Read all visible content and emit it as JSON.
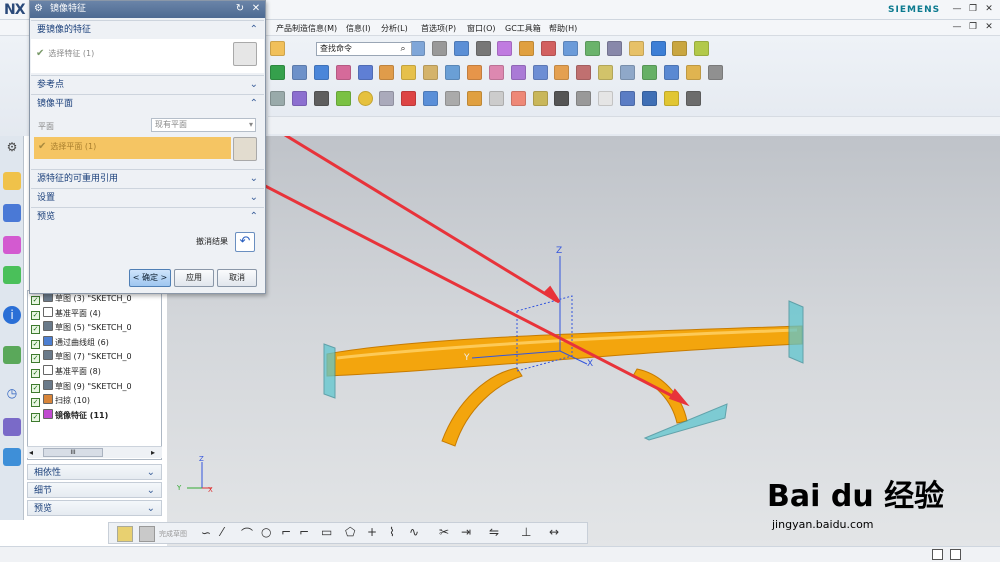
{
  "app": {
    "logo": "NX",
    "brand": "SIEMENS",
    "window_controls": [
      "?",
      "—",
      "❐",
      "✕"
    ]
  },
  "menubar": {
    "items": [
      "产品制造信息(M)",
      "信息(I)",
      "分析(L)",
      "首选项(P)",
      "窗口(O)",
      "GC工具箱",
      "帮助(H)"
    ]
  },
  "toolbar": {
    "command_search_placeholder": "查找命令"
  },
  "dialog": {
    "title": "镜像特征",
    "sections": {
      "features_to_mirror": "要镜像的特征",
      "select_feature": "选择特征 (1)",
      "reference_point": "参考点",
      "mirror_plane": "镜像平面",
      "plane_label": "平面",
      "plane_value": "现有平面",
      "select_plane": "选择平面 (1)",
      "reusable_refs": "源特征的可重用引用",
      "settings": "设置",
      "preview": "预览",
      "undo_result": "撤消结果"
    },
    "buttons": {
      "ok": "< 确定 >",
      "apply": "应用",
      "cancel": "取消"
    }
  },
  "navigator": {
    "rows": [
      {
        "label": "草图 (3) \"SKETCH_0",
        "icon": "sketch-icon",
        "color": "#6a7a8a"
      },
      {
        "label": "基准平面 (4)",
        "icon": "datum-plane-icon",
        "color": "#ffffff"
      },
      {
        "label": "草图 (5) \"SKETCH_0",
        "icon": "sketch-icon",
        "color": "#6a7a8a"
      },
      {
        "label": "通过曲线组 (6)",
        "icon": "through-curves-icon",
        "color": "#4d7fd1"
      },
      {
        "label": "草图 (7) \"SKETCH_0",
        "icon": "sketch-icon",
        "color": "#6a7a8a"
      },
      {
        "label": "基准平面 (8)",
        "icon": "datum-plane-icon",
        "color": "#ffffff"
      },
      {
        "label": "草图 (9) \"SKETCH_0",
        "icon": "sketch-icon",
        "color": "#6a7a8a"
      },
      {
        "label": "扫掠 (10)",
        "icon": "swept-icon",
        "color": "#d8853a"
      },
      {
        "label": "镜像特征 (11)",
        "icon": "mirror-feature-icon",
        "color": "#c04ad0"
      }
    ],
    "scroll_label": "III",
    "panels": [
      "相依性",
      "细节",
      "预览"
    ]
  },
  "sketchbar": {
    "finish_label": "完成草图"
  },
  "viewport": {
    "axis_z": "Z",
    "axis_y": "Y",
    "axis_x": "X",
    "triad_z": "Z",
    "triad_y": "Y",
    "triad_x": "X",
    "model_color": "#f3a50d",
    "plane_color": "#5fc6cf"
  },
  "watermark": {
    "brand": "Bai du 经验",
    "url": "jingyan.baidu.com"
  }
}
